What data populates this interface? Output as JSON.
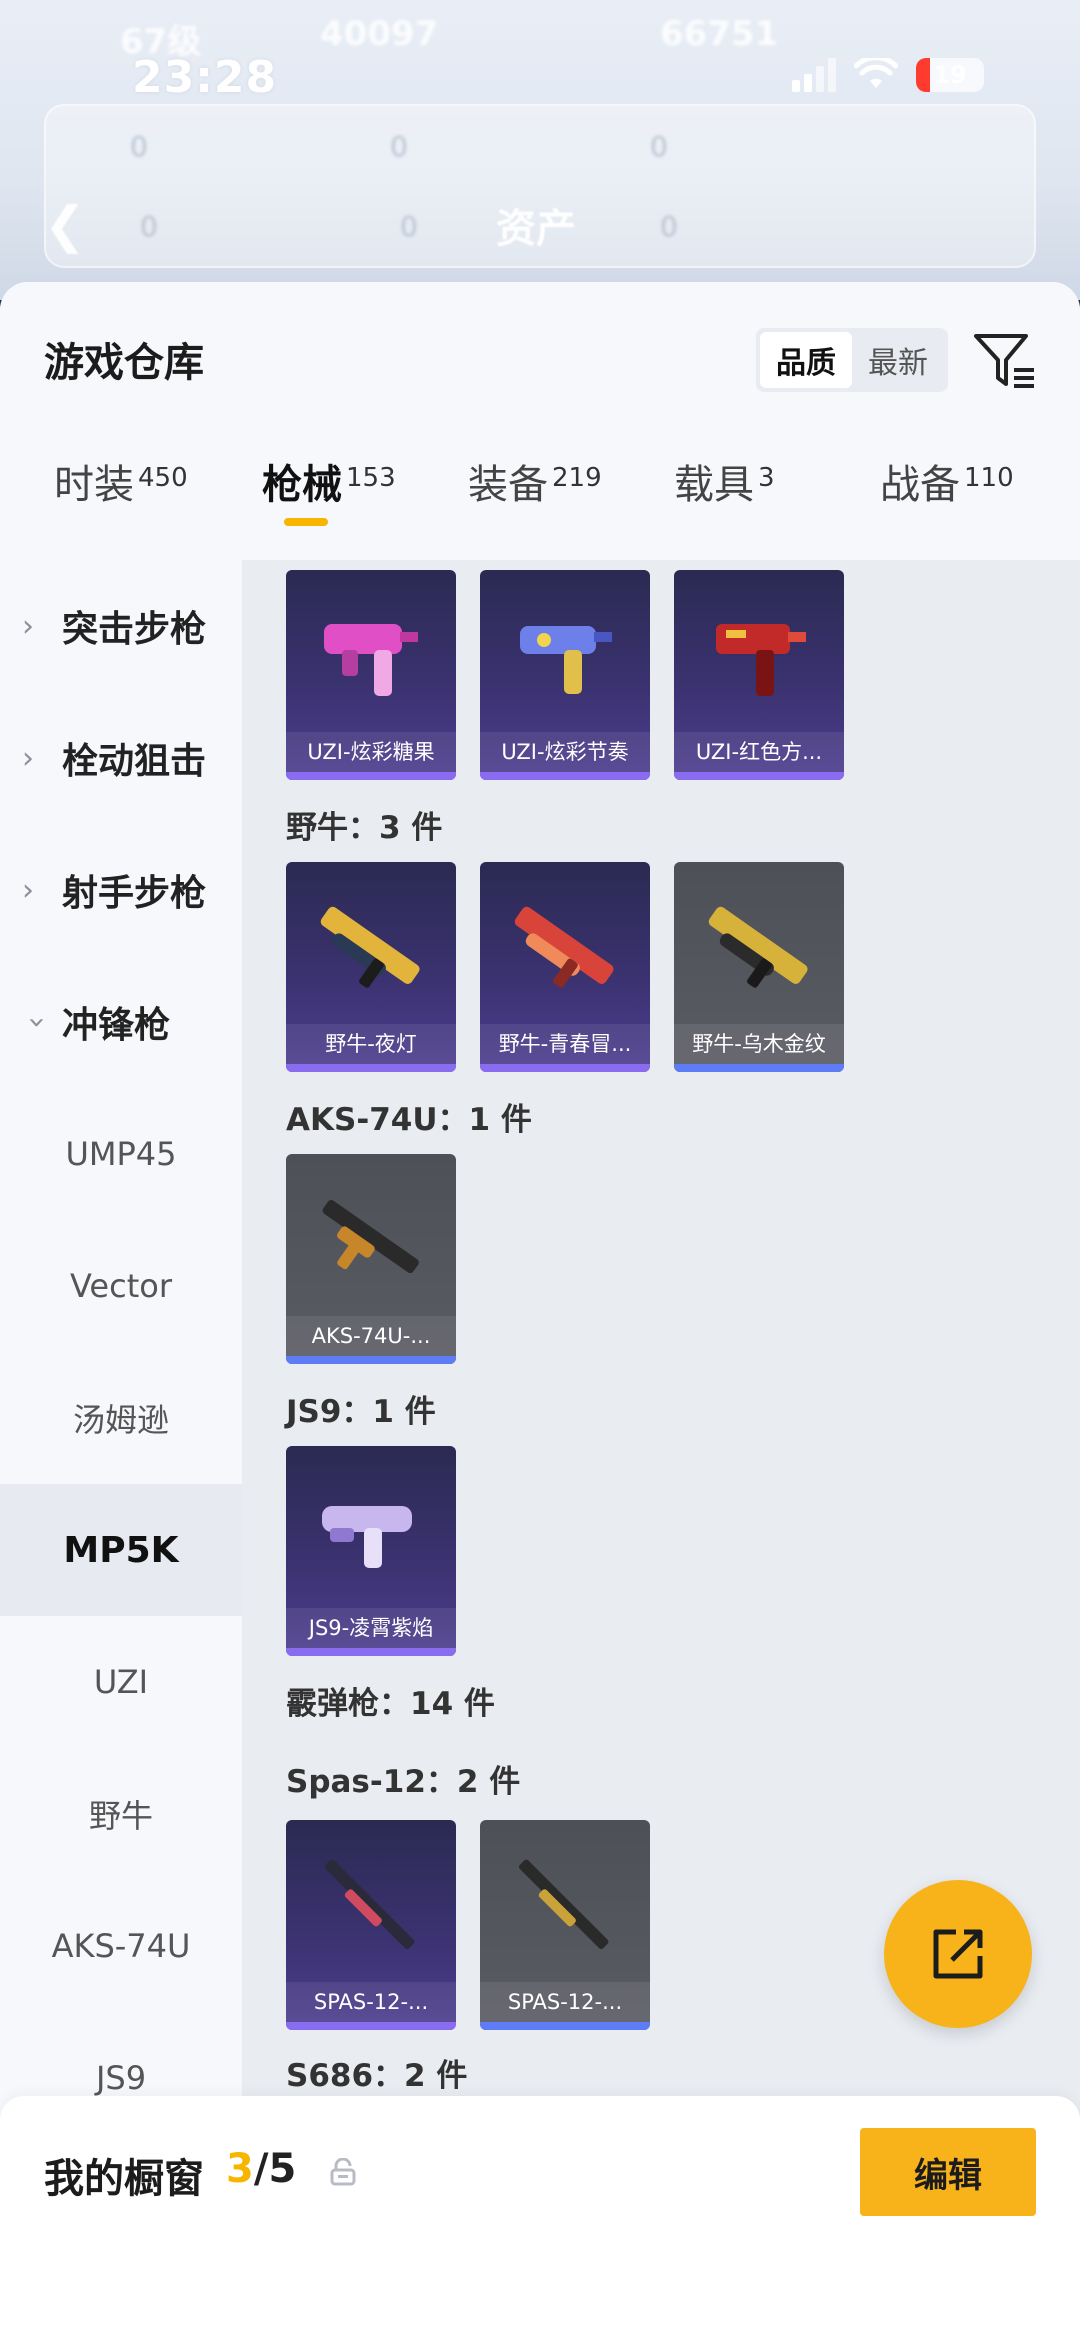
{
  "status": {
    "time": "23:28",
    "battery": "19"
  },
  "background": {
    "title": "资产",
    "ghost_level": "67级",
    "ghost_coins": "40097",
    "ghost_points": "66751",
    "ghost_row1": [
      "0",
      "0",
      "0"
    ],
    "ghost_row2": [
      "0",
      "0",
      "0"
    ]
  },
  "header": {
    "title": "游戏仓库",
    "sort_options": [
      "品质",
      "最新"
    ],
    "active_sort": "品质"
  },
  "tabs": [
    {
      "label": "时装",
      "count": "450"
    },
    {
      "label": "枪械",
      "count": "153"
    },
    {
      "label": "装备",
      "count": "219"
    },
    {
      "label": "载具",
      "count": "3"
    },
    {
      "label": "战备",
      "count": "110"
    }
  ],
  "sidebar": {
    "categories": [
      {
        "label": "突击步枪",
        "expanded": false
      },
      {
        "label": "栓动狙击",
        "expanded": false
      },
      {
        "label": "射手步枪",
        "expanded": false
      },
      {
        "label": "冲锋枪",
        "expanded": true
      }
    ],
    "subitems": [
      "UMP45",
      "Vector",
      "汤姆逊",
      "MP5K",
      "UZI",
      "野牛",
      "AKS-74U",
      "JS9"
    ],
    "selected": "MP5K"
  },
  "content": {
    "uzi_cards": [
      "UZI-炫彩糖果",
      "UZI-炫彩节奏",
      "UZI-红色方..."
    ],
    "bizon_title": "野牛：3 件",
    "bizon_cards": [
      "野牛-夜灯",
      "野牛-青春冒...",
      "野牛-乌木金纹"
    ],
    "aks_title": "AKS-74U：1 件",
    "aks_cards": [
      "AKS-74U-..."
    ],
    "js9_title": "JS9：1 件",
    "js9_cards": [
      "JS9-凌霄紫焰"
    ],
    "shotgun_title": "霰弹枪：14 件",
    "spas_title": "Spas-12：2 件",
    "spas_cards": [
      "SPAS-12-...",
      "SPAS-12-..."
    ],
    "s686_title": "S686：2 件"
  },
  "showcase": {
    "label": "我的橱窗",
    "current": "3",
    "total": "/5",
    "edit_label": "编辑"
  },
  "colors": {
    "accent": "#f8b21a",
    "purple_rarity": "#8a6cf0",
    "blue_rarity": "#5d7cf5"
  }
}
